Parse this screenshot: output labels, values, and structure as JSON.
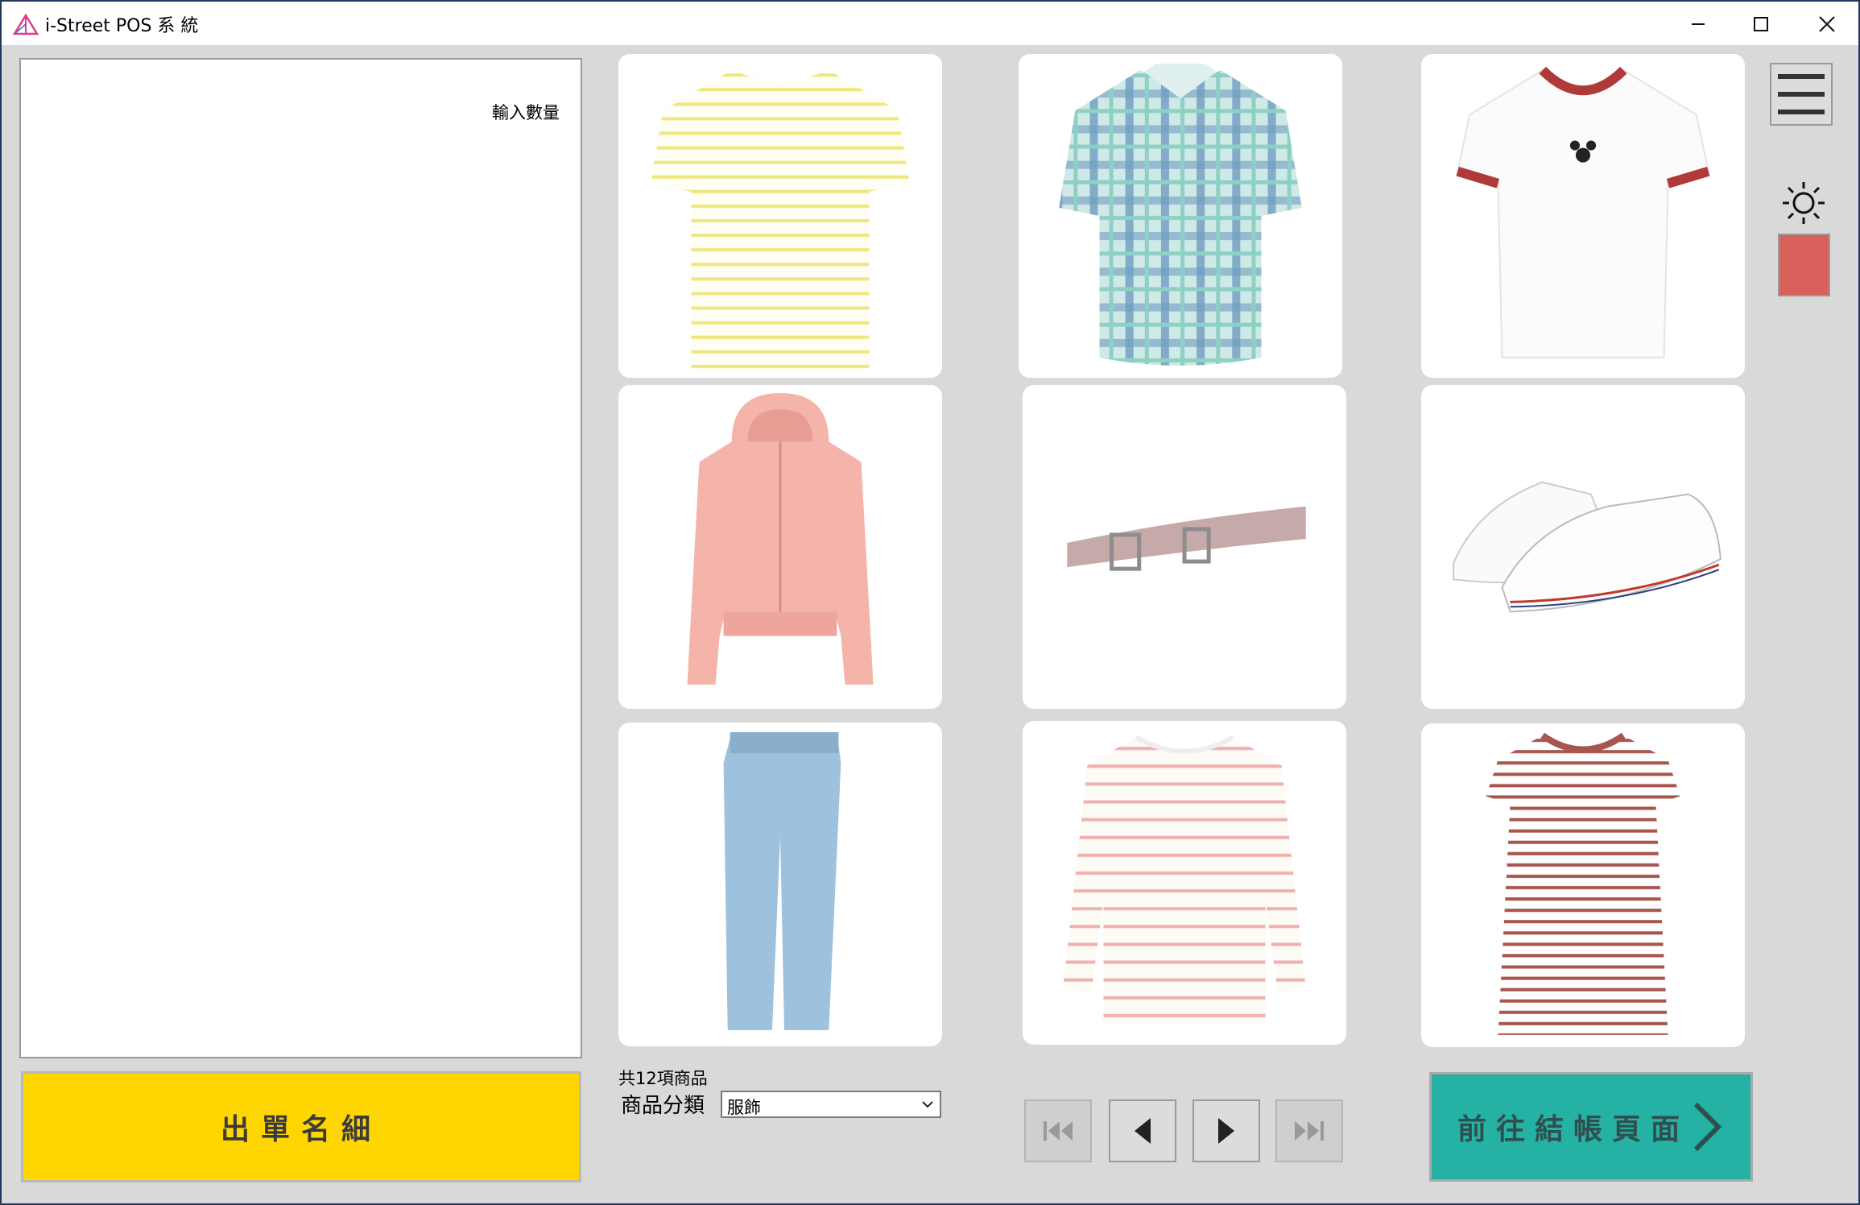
{
  "window": {
    "title": "i-Street POS 系 統",
    "icon": "app-triangle-icon",
    "controls": [
      "minimize-icon",
      "maximize-icon",
      "close-icon"
    ]
  },
  "order_panel": {
    "qty_label": "輸入數量"
  },
  "detail_button": {
    "label": "出單名細"
  },
  "products": [
    {
      "item": "yellow-striped-tshirt",
      "colors": [
        "#f0e68c",
        "#ffffff"
      ]
    },
    {
      "item": "blue-plaid-shirt",
      "colors": [
        "#7fb3c8",
        "#a8d8d0"
      ]
    },
    {
      "item": "white-ringer-tshirt-mickey",
      "colors": [
        "#ffffff",
        "#b03a3a"
      ]
    },
    {
      "item": "pink-zip-hoodie",
      "colors": [
        "#f4b4aa"
      ]
    },
    {
      "item": "mauve-leather-belt",
      "colors": [
        "#c6a9a9"
      ]
    },
    {
      "item": "white-canvas-sneakers",
      "colors": [
        "#ffffff",
        "#c0392b"
      ]
    },
    {
      "item": "light-wash-jeans",
      "colors": [
        "#9ec2dd"
      ]
    },
    {
      "item": "pink-striped-sweater",
      "colors": [
        "#fbfaf5",
        "#f0b1ae"
      ]
    },
    {
      "item": "red-striped-tshirt-dress",
      "colors": [
        "#ffffff",
        "#a8554e"
      ]
    }
  ],
  "footer": {
    "count_label": "共12項商品",
    "category_label": "商品分類",
    "category_value": "服飾"
  },
  "pagination": {
    "first": "first-page-icon",
    "prev": "prev-page-icon",
    "next": "next-page-icon",
    "last": "last-page-icon"
  },
  "checkout_button": {
    "label": "前往結帳頁面",
    "icon": "chevron-right-icon"
  },
  "side": {
    "menu_icon": "hamburger-menu-icon",
    "theme_icon": "sun-icon",
    "swatch_color": "#d9605b"
  },
  "colors": {
    "background": "#d9d9d9",
    "detail_button": "#ffd600",
    "checkout_button": "#25b1a3",
    "window_border": "#24365e"
  }
}
